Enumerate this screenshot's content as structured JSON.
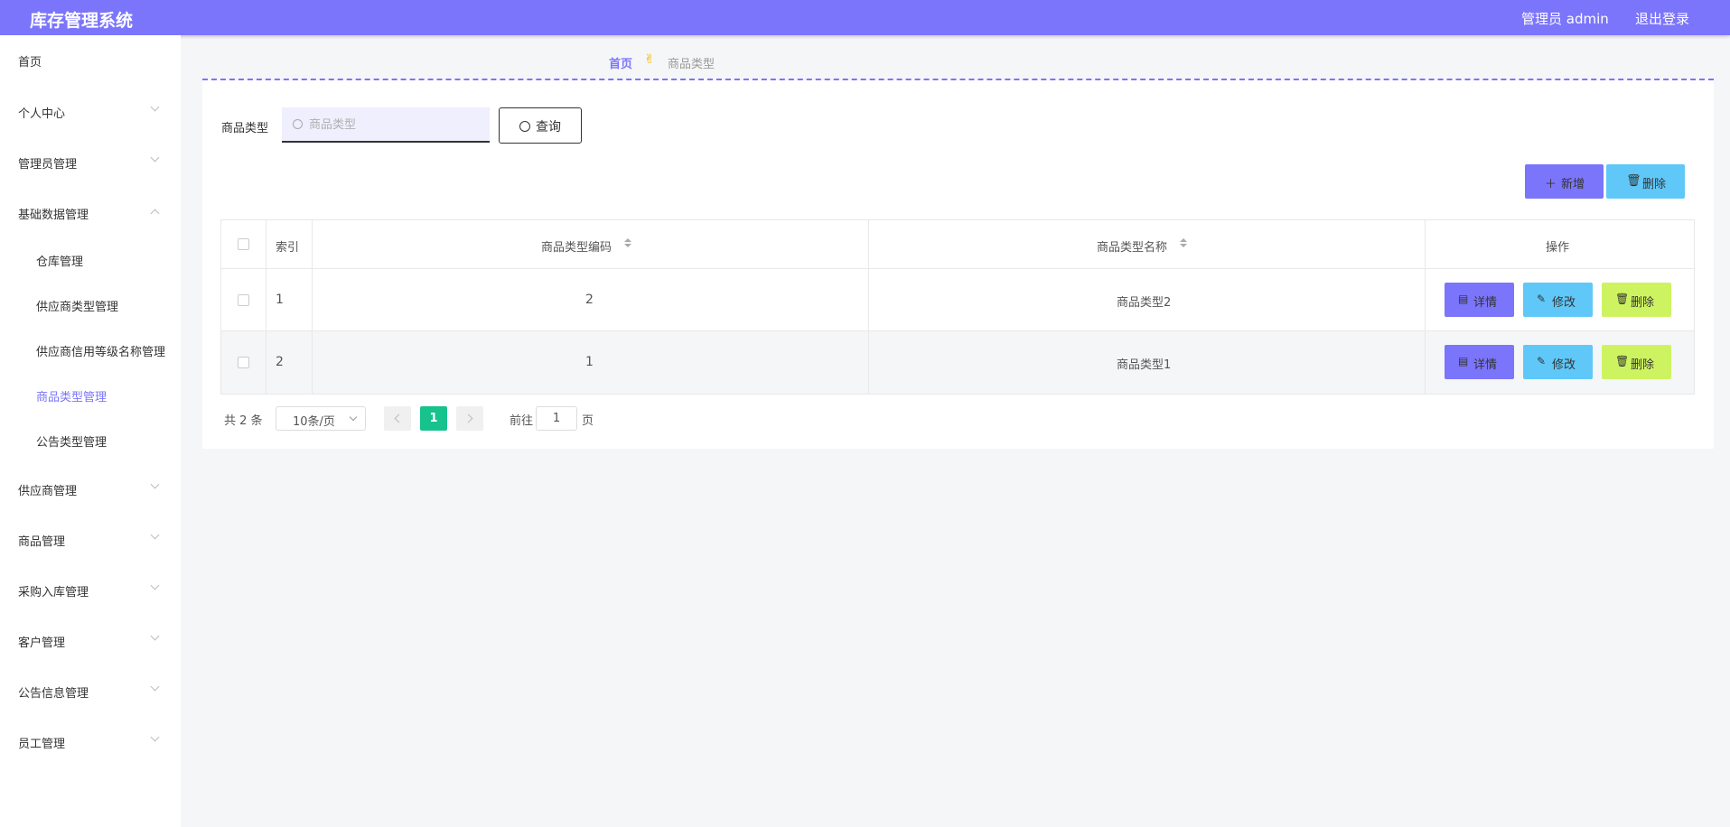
{
  "header": {
    "app_title": "库存管理系统",
    "admin_label": "管理员 admin",
    "logout": "退出登录"
  },
  "sidebar": {
    "items": [
      {
        "label": "首页"
      },
      {
        "label": "个人中心"
      },
      {
        "label": "管理员管理"
      },
      {
        "label": "基础数据管理"
      },
      {
        "label": "仓库管理"
      },
      {
        "label": "供应商类型管理"
      },
      {
        "label": "供应商信用等级名称管理"
      },
      {
        "label": "商品类型管理"
      },
      {
        "label": "公告类型管理"
      },
      {
        "label": "供应商管理"
      },
      {
        "label": "商品管理"
      },
      {
        "label": "采购入库管理"
      },
      {
        "label": "客户管理"
      },
      {
        "label": "公告信息管理"
      },
      {
        "label": "员工管理"
      }
    ]
  },
  "breadcrumb": {
    "home": "首页",
    "current": "商品类型"
  },
  "search": {
    "label": "商品类型",
    "placeholder": "商品类型",
    "query_button": "查询"
  },
  "actions": {
    "add": "新增",
    "delete": "删除"
  },
  "table": {
    "headers": {
      "index": "索引",
      "code": "商品类型编码",
      "name": "商品类型名称",
      "ops": "操作"
    },
    "rows": [
      {
        "index": "1",
        "code": "2",
        "name": "商品类型2"
      },
      {
        "index": "2",
        "code": "1",
        "name": "商品类型1"
      }
    ],
    "ops": {
      "detail": "详情",
      "edit": "修改",
      "delete": "删除"
    }
  },
  "pagination": {
    "total": "共 2 条",
    "page_size": "10条/页",
    "current": "1",
    "goto_label": "前往",
    "goto_value": "1",
    "page_suffix": "页"
  },
  "colors": {
    "primary": "#7b75fb",
    "info": "#5fc8f8",
    "warning": "#cdf460",
    "success": "#17c28c"
  }
}
